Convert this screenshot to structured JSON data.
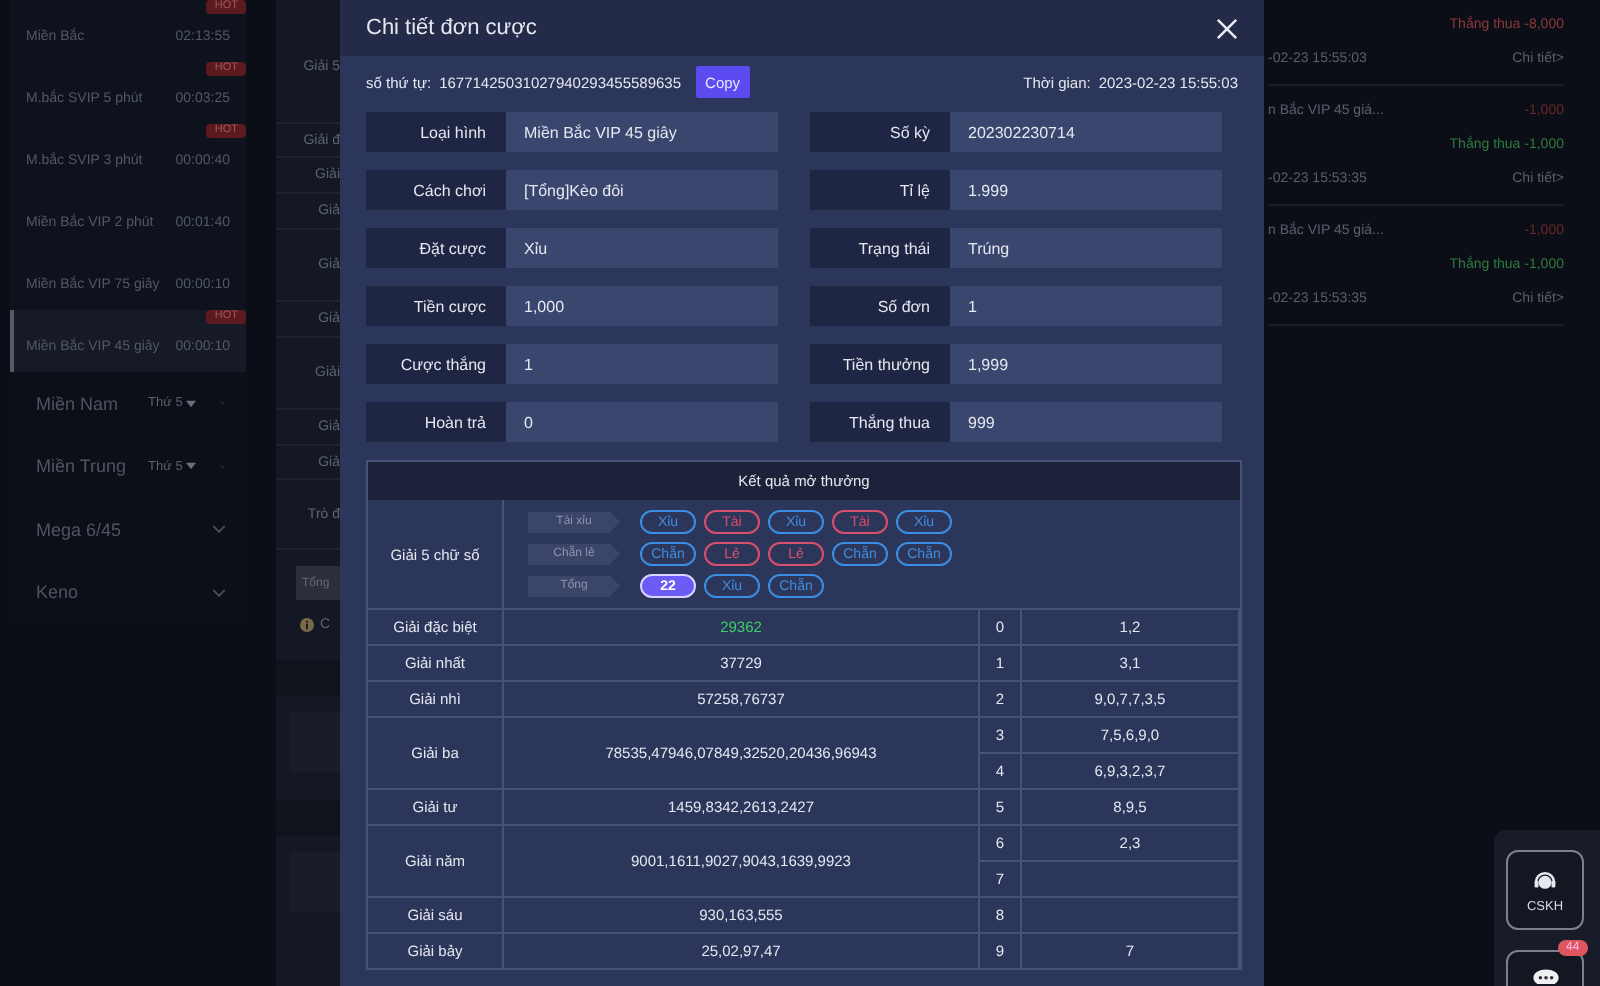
{
  "sidebar": {
    "items": [
      {
        "name": "Miền Bắc",
        "time": "02:13:55",
        "badge": "HOT",
        "selected": false
      },
      {
        "name": "M.bắc SVIP 5 phút",
        "time": "00:03:25",
        "badge": "HOT",
        "selected": false
      },
      {
        "name": "M.bắc SVIP 3 phút",
        "time": "00:00:40",
        "badge": "HOT",
        "selected": false
      },
      {
        "name": "Miền Bắc VIP 2 phút",
        "time": "00:01:40",
        "selected": false
      },
      {
        "name": "Miền Bắc VIP 75 giây",
        "time": "00:00:10",
        "selected": false
      },
      {
        "name": "Miền Bắc VIP 45 giây",
        "time": "00:00:10",
        "badge": "HOT",
        "selected": true
      }
    ],
    "groups": [
      {
        "name": "Miền Nam",
        "day": "Thứ 5"
      },
      {
        "name": "Miền Trung",
        "day": "Thứ 5"
      },
      {
        "name": "Mega 6/45"
      },
      {
        "name": "Keno"
      }
    ]
  },
  "background_table": {
    "labels": [
      "Giải 5",
      "Giải đ",
      "Giải",
      "Giả",
      "Giả",
      "Giả",
      "Giải",
      "Giả",
      "Giả",
      "Trò đ"
    ],
    "total_field": "Tổng",
    "note": "C"
  },
  "records": [
    {
      "result": "Thắng thua -8,000",
      "color": "#8a3a3a",
      "time": "-02-23 15:55:03",
      "link": "Chi tiết>"
    },
    {
      "name": "n Bắc VIP 45 giá...",
      "amount": "-1,000",
      "result": "Thắng thua -1,000",
      "color": "#2f7a3f",
      "time": "-02-23 15:53:35",
      "link": "Chi tiết>"
    },
    {
      "name": "n Bắc VIP 45 giá...",
      "amount": "-1,000",
      "result": "Thắng thua -1,000",
      "color": "#2f7a3f",
      "time": "-02-23 15:53:35",
      "link": "Chi tiết>"
    }
  ],
  "dialog": {
    "title": "Chi tiết đơn cược",
    "order_label": "số thứ tự:",
    "order_number": "16771425031027940293455589635",
    "copy_button": "Copy",
    "time_label": "Thời gian:",
    "time": "2023-02-23 15:55:03",
    "fields": [
      {
        "label": "Loại hình",
        "value": "Miền Bắc VIP 45 giây"
      },
      {
        "label": "Số kỳ",
        "value": "202302230714"
      },
      {
        "label": "Cách chơi",
        "value": "[Tổng]Kèo đôi"
      },
      {
        "label": "Tỉ lệ",
        "value": "1.999"
      },
      {
        "label": "Đặt cược",
        "value": "Xỉu"
      },
      {
        "label": "Trạng thái",
        "value": "Trúng"
      },
      {
        "label": "Tiền cược",
        "value": "1,000"
      },
      {
        "label": "Số đơn",
        "value": "1"
      },
      {
        "label": "Cược thắng",
        "value": "1"
      },
      {
        "label": "Tiền thưởng",
        "value": "1,999"
      },
      {
        "label": "Hoàn trả",
        "value": "0"
      },
      {
        "label": "Thắng thua",
        "value": "999"
      }
    ],
    "results": {
      "title": "Kết quả mở thưởng",
      "five_digit_label": "Giải 5 chữ số",
      "tag_rows": [
        {
          "label": "Tài xỉu",
          "chips": [
            {
              "text": "Xỉu",
              "color": "#3d8de0",
              "filled": false
            },
            {
              "text": "Tài",
              "color": "#d9506a",
              "filled": false
            },
            {
              "text": "Xỉu",
              "color": "#3d8de0",
              "filled": false
            },
            {
              "text": "Tài",
              "color": "#d9506a",
              "filled": false
            },
            {
              "text": "Xỉu",
              "color": "#3d8de0",
              "filled": false
            }
          ]
        },
        {
          "label": "Chẵn lẻ",
          "chips": [
            {
              "text": "Chẵn",
              "color": "#3d8de0",
              "filled": false
            },
            {
              "text": "Lẻ",
              "color": "#d9506a",
              "filled": false
            },
            {
              "text": "Lẻ",
              "color": "#d9506a",
              "filled": false
            },
            {
              "text": "Chẵn",
              "color": "#3d8de0",
              "filled": false
            },
            {
              "text": "Chẵn",
              "color": "#3d8de0",
              "filled": false
            }
          ]
        },
        {
          "label": "Tổng",
          "chips": [
            {
              "text": "22",
              "color": "#6c5cf5",
              "filled": true
            },
            {
              "text": "Xỉu",
              "color": "#3d8de0",
              "filled": false
            },
            {
              "text": "Chẵn",
              "color": "#3d8de0",
              "filled": false
            }
          ]
        }
      ],
      "prizes": [
        {
          "name": "Giải đặc biệt",
          "numbers": "29362",
          "highlighted": true,
          "tails": [
            {
              "digit": "0",
              "values": "1,2"
            }
          ]
        },
        {
          "name": "Giải nhất",
          "numbers": "37729",
          "highlighted": false,
          "tails": [
            {
              "digit": "1",
              "values": "3,1"
            }
          ]
        },
        {
          "name": "Giải nhì",
          "numbers": "57258,76737",
          "highlighted": false,
          "tails": [
            {
              "digit": "2",
              "values": "9,0,7,7,3,5"
            }
          ]
        },
        {
          "name": "Giải ba",
          "numbers": "78535,47946,07849,32520,20436,96943",
          "highlighted": false,
          "tails": [
            {
              "digit": "3",
              "values": "7,5,6,9,0"
            },
            {
              "digit": "4",
              "values": "6,9,3,2,3,7"
            }
          ]
        },
        {
          "name": "Giải tư",
          "numbers": "1459,8342,2613,2427",
          "highlighted": false,
          "tails": [
            {
              "digit": "5",
              "values": "8,9,5"
            }
          ]
        },
        {
          "name": "Giải năm",
          "numbers": "9001,1611,9027,9043,1639,9923",
          "highlighted": false,
          "tails": [
            {
              "digit": "6",
              "values": "2,3"
            },
            {
              "digit": "7"
            }
          ]
        },
        {
          "name": "Giải sáu",
          "numbers": "930,163,555",
          "highlighted": false,
          "tails": [
            {
              "digit": "8"
            }
          ]
        },
        {
          "name": "Giải bảy",
          "numbers": "25,02,97,47",
          "highlighted": false,
          "tails": [
            {
              "digit": "9",
              "values": "7"
            }
          ]
        }
      ]
    }
  },
  "support": {
    "cskh": "CSKH",
    "chat_badge": "44"
  }
}
